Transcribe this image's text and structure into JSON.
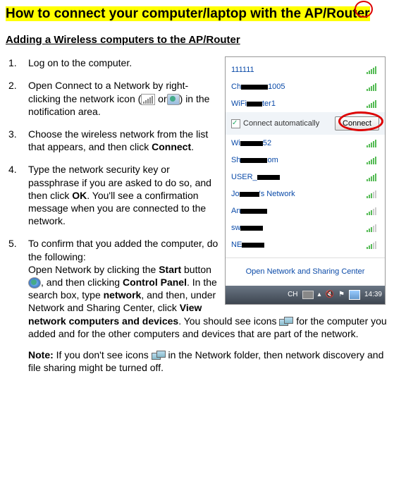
{
  "title": "How to connect your computer/laptop with the AP/Router",
  "subtitle": "Adding a Wireless computers to the AP/Router",
  "steps": {
    "s1": "Log on to the computer.",
    "s2a": "Open Connect to a Network by right-clicking the network icon (",
    "s2b": " or",
    "s2c": ") in the notification area.",
    "s3a": "Choose the wireless network from the list that appears, and then click ",
    "s3b": "Connect",
    "s3c": ".",
    "s4a": "Type the network security key or passphrase if you are asked to do so, and then click ",
    "s4b": "OK",
    "s4c": ". You'll see a confirmation message when you are connected to the network.",
    "s5a": "To confirm that you added the computer, do the following:",
    "s5b": "Open Network by clicking the ",
    "s5c": "Start",
    "s5d": " button",
    "s5e": ", and then clicking ",
    "s5f": "Control Panel",
    "s5g": ". In the search box, type ",
    "s5h": "network",
    "s5i": ", and then, under Network and Sharing Center, click ",
    "s5j": "View network computers and devices",
    "s5k": ". You should see icons ",
    "s5l": " for the computer you added and for the other computers and devices that are part of the network."
  },
  "note": {
    "label": "Note:",
    "a": " If you don't see icons ",
    "b": " in the Network folder, then network discovery and file sharing might be turned off."
  },
  "wifi_popup": {
    "nets": {
      "n1": "111111",
      "n2a": "Ch",
      "n2b": "1005",
      "n3": "WiFi",
      "n3b": "ter1",
      "n4a": "Wi",
      "n4b": "52",
      "n5": "Sh",
      "n5b": "om",
      "n6": "USER_",
      "n7a": "Jo",
      "n7b": "'s Network",
      "n8": "An",
      "n9": "sw",
      "n10": "NE"
    },
    "auto_label": "Connect automatically",
    "connect_label": "Connect",
    "open_center": "Open Network and Sharing Center",
    "taskbar": {
      "lang": "CH",
      "time": "14:39"
    }
  }
}
